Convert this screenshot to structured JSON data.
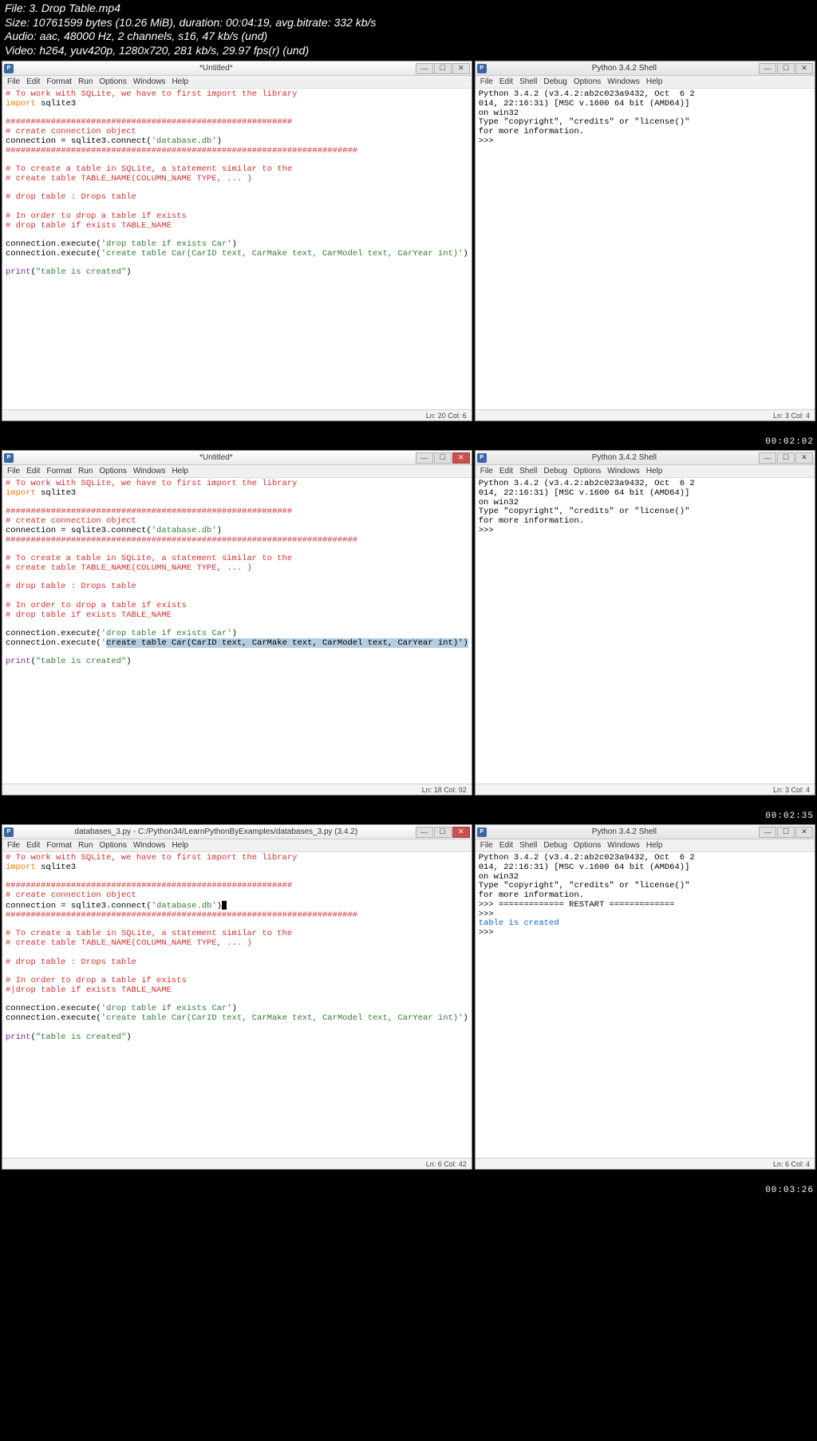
{
  "meta": {
    "line1": "File: 3. Drop Table.mp4",
    "line2": "Size: 10761599 bytes (10.26 MiB), duration: 00:04:19, avg.bitrate: 332 kb/s",
    "line3": "Audio: aac, 48000 Hz, 2 channels, s16, 47 kb/s (und)",
    "line4": "Video: h264, yuv420p, 1280x720, 281 kb/s, 29.97 fps(r) (und)"
  },
  "timestamps": {
    "f1": "00:02:02",
    "f2": "00:02:35",
    "f3": "00:03:26"
  },
  "titles": {
    "editor1": "*Untitled*",
    "editor2": "*Untitled*",
    "editor3": "databases_3.py - C:/Python34/LearnPythonByExamples/databases_3.py (3.4.2)",
    "shell": "Python 3.4.2 Shell"
  },
  "menus": {
    "editor": [
      "File",
      "Edit",
      "Format",
      "Run",
      "Options",
      "Windows",
      "Help"
    ],
    "shell": [
      "File",
      "Edit",
      "Shell",
      "Debug",
      "Options",
      "Windows",
      "Help"
    ]
  },
  "code": {
    "l1": "# To work with SQLite, we have to first import the library",
    "kw_import": "import",
    "mod": " sqlite3",
    "hr1": "#########################################################",
    "hr2": "######################################################################",
    "c_conn": "# create connection object",
    "conn1": "connection = sqlite3.connect(",
    "conn2": "'database.db'",
    "conn3": ")",
    "c_tbla": "# To create a table in SQLite, a statement similar to the",
    "c_tblb": "# create table TABLE_NAME(COLUMN_NAME TYPE, ... )",
    "c_drop": "# drop table : Drops table",
    "c_if1": "# In order to drop a table if exists",
    "c_if2": "# drop table if exists TABLE_NAME",
    "c_if2b": "#|drop table if exists TABLE_NAME",
    "exec1a": "connection.execute(",
    "exec1b": "'drop table if exists Car'",
    "exec1c": ")",
    "exec2a": "connection.execute(",
    "exec2b": "'create table Car(CarID text, CarMake text, CarModel text, CarYear int)'",
    "exec2c": ")",
    "sel2": "create table Car(CarID text, CarMake text, CarModel text, CarYear int)')",
    "pr1": "print",
    "pr2": "(",
    "pr3": "\"table is created\"",
    "pr4": ")"
  },
  "shell": {
    "s1": "Python 3.4.2 (v3.4.2:ab2c023a9432, Oct  6 2",
    "s2": "014, 22:16:31) [MSC v.1600 64 bit (AMD64)]",
    "s3": "on win32",
    "s4": "Type \"copyright\", \"credits\" or \"license()\"",
    "s5": "for more information.",
    "prompt": ">>> ",
    "restart": ">>> ============= RESTART =============",
    "out": "table is created"
  },
  "status": {
    "e1": "Ln: 20 Col: 6",
    "e2": "Ln: 18 Col: 92",
    "e3": "Ln: 6 Col: 42",
    "s": "Ln: 3 Col: 4",
    "s3": "Ln: 6 Col: 4"
  }
}
